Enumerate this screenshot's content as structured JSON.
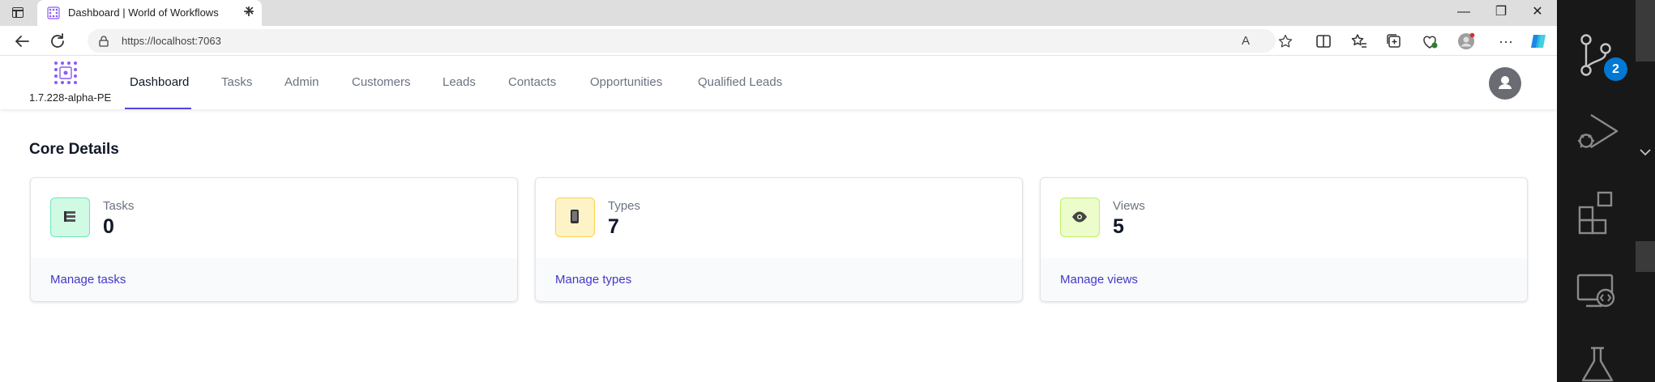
{
  "browser": {
    "tab_title": "Dashboard | World of Workflows",
    "new_tab_label": "+",
    "close_tab_label": "✕",
    "url": "https://localhost:7063",
    "window_controls": {
      "minimize": "—",
      "restore": "❐",
      "close": "✕"
    }
  },
  "app": {
    "version": "1.7.228-alpha-PE",
    "nav": [
      {
        "label": "Dashboard"
      },
      {
        "label": "Tasks"
      },
      {
        "label": "Admin"
      },
      {
        "label": "Customers"
      },
      {
        "label": "Leads"
      },
      {
        "label": "Contacts"
      },
      {
        "label": "Opportunities"
      },
      {
        "label": "Qualified Leads"
      }
    ],
    "section_title": "Core Details",
    "cards": [
      {
        "label": "Tasks",
        "value": "0",
        "link": "Manage tasks",
        "icon": "list-icon",
        "accent_bg": "#d1fae5",
        "accent_border": "#6ee7b7"
      },
      {
        "label": "Types",
        "value": "7",
        "link": "Manage types",
        "icon": "device-icon",
        "accent_bg": "#fef3c7",
        "accent_border": "#fcd34d"
      },
      {
        "label": "Views",
        "value": "5",
        "link": "Manage views",
        "icon": "eye-icon",
        "accent_bg": "#ecfccb",
        "accent_border": "#bef264"
      }
    ]
  },
  "vscode": {
    "source_control_badge": "2"
  },
  "colors": {
    "accent": "#4f46e5",
    "link": "#4338ca",
    "vscode_bg": "#181818",
    "badge": "#0078d4"
  }
}
